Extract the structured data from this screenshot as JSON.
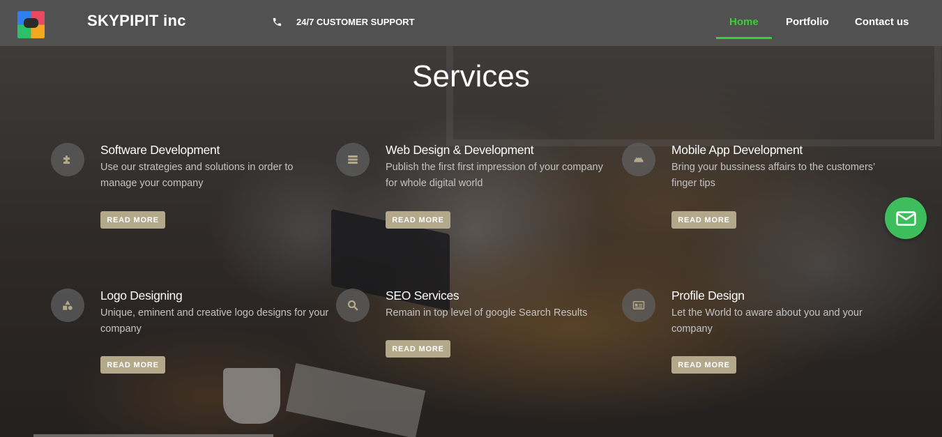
{
  "header": {
    "brand": "SKYPIPIT inc",
    "support_text": "24/7 CUSTOMER SUPPORT",
    "nav": [
      {
        "label": "Home",
        "active": true
      },
      {
        "label": "Portfolio",
        "active": false
      },
      {
        "label": "Contact us",
        "active": false
      }
    ]
  },
  "colors": {
    "accent_green": "#39d12e",
    "button_bg": "#b3a889",
    "mail_button": "#3dbd5c"
  },
  "main": {
    "title": "Services",
    "services": [
      {
        "title": "Software Development",
        "description": "Use our strategies and solutions in order to manage your company",
        "button": "READ MORE",
        "icon": "puzzle-icon"
      },
      {
        "title": "Web Design & Development",
        "description": "Publish the first first impression of your company for whole digital world",
        "button": "READ MORE",
        "icon": "server-icon"
      },
      {
        "title": "Mobile App Development",
        "description": "Bring your bussiness affairs to the customers’ finger tips",
        "button": "READ MORE",
        "icon": "android-icon"
      },
      {
        "title": "Logo Designing",
        "description": "Unique, eminent and creative logo designs for your company",
        "button": "READ MORE",
        "icon": "shapes-icon"
      },
      {
        "title": "SEO Services",
        "description": "Remain in top level of google Search Results",
        "button": "READ MORE",
        "icon": "search-icon"
      },
      {
        "title": "Profile Design",
        "description": "Let the World to aware about you and your company",
        "button": "READ MORE",
        "icon": "id-card-icon"
      }
    ]
  },
  "floating": {
    "icon": "mail-icon"
  }
}
